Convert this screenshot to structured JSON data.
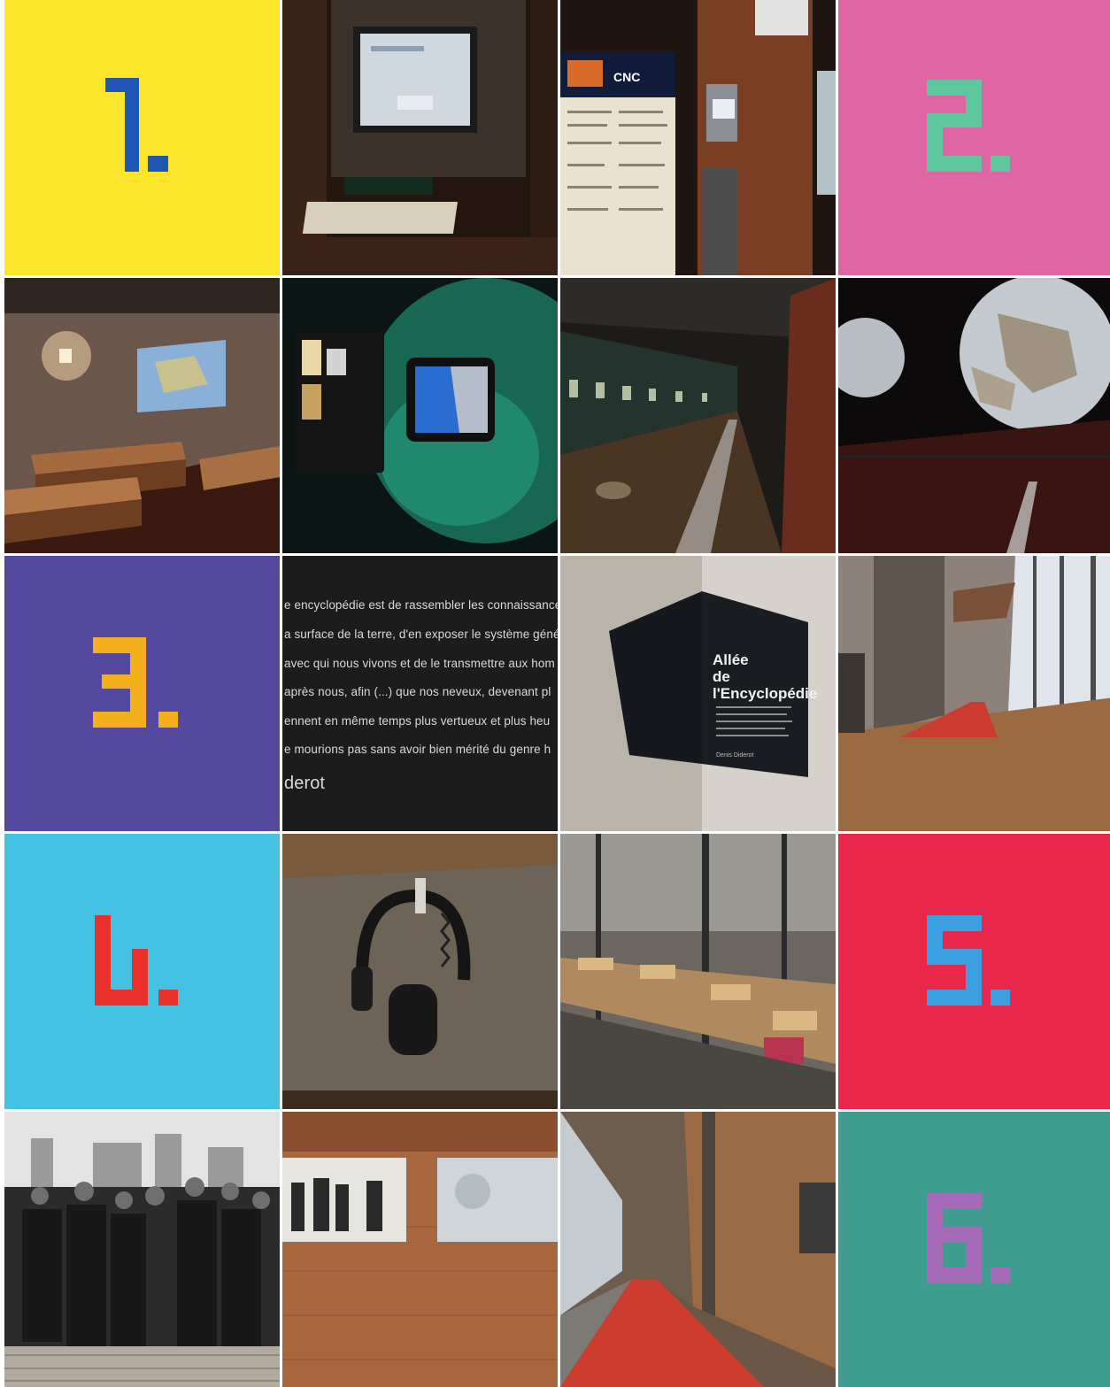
{
  "tiles": {
    "n1": {
      "label": "1.",
      "bg": "#fce52a",
      "fg": "#1f56b5"
    },
    "n2": {
      "label": "2.",
      "bg": "#e065a4",
      "fg": "#5fc79e"
    },
    "n3": {
      "label": "3.",
      "bg": "#54489f",
      "fg": "#f4b01c"
    },
    "n4": {
      "label": "4.",
      "bg": "#45c1e3",
      "fg": "#e8312b"
    },
    "n5": {
      "label": "5.",
      "bg": "#e8274a",
      "fg": "#3aa0df"
    },
    "n6": {
      "label": "6.",
      "bg": "#3e9d8f",
      "fg": "#a56bb8"
    }
  },
  "quote": {
    "lines": [
      "e encyclopédie est de rassembler les connaissance",
      "a surface de la terre, d'en exposer le système géné",
      "avec qui nous vivons et de le transmettre aux hom",
      "après nous, afin (...) que nos neveux, devenant pl",
      "ennent en même temps plus vertueux et plus heu",
      "e mourions pas sans avoir bien mérité du genre h"
    ],
    "signature": "derot"
  },
  "sign": {
    "title_line1": "Allée",
    "title_line2": "de l'Encyclopédie",
    "author": "Denis Diderot"
  },
  "kiosk": {
    "cnc": "CNC"
  }
}
